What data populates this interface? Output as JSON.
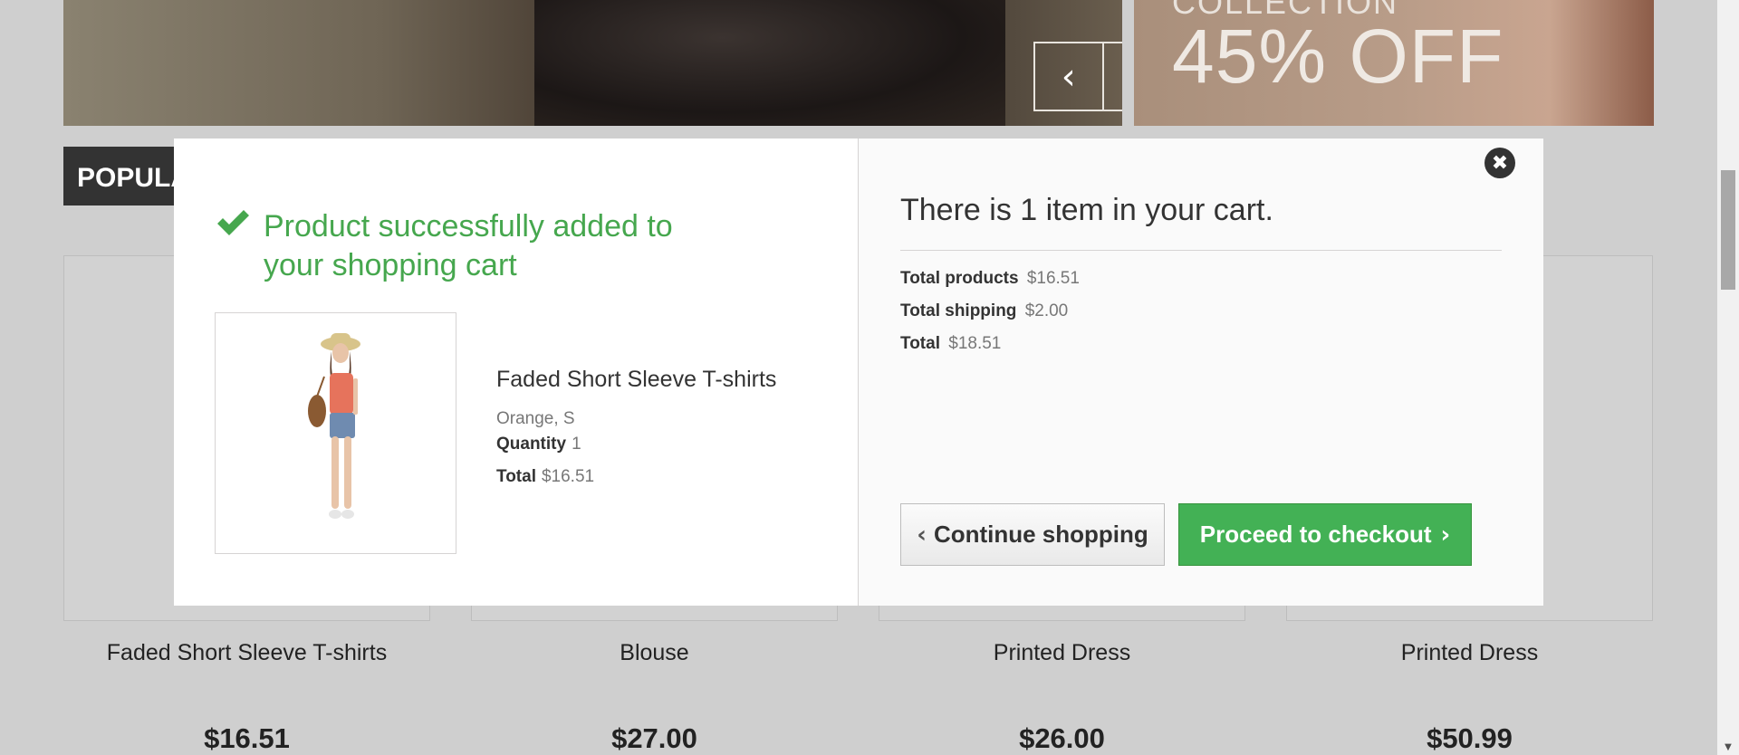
{
  "background": {
    "promo": {
      "collection_text": "COLLECTION",
      "discount_text": "45% OFF"
    },
    "slider": {
      "prev_glyph": "‹",
      "next_glyph": "›"
    },
    "popular_tab": "POPULAR",
    "products": [
      {
        "name": "Faded Short Sleeve T-shirts",
        "price": "$16.51"
      },
      {
        "name": "Blouse",
        "price": "$27.00"
      },
      {
        "name": "Printed Dress",
        "price": "$26.00"
      },
      {
        "name": "Printed Dress",
        "price": "$50.99"
      }
    ]
  },
  "modal": {
    "success_message": "Product successfully added to your shopping cart",
    "product": {
      "name": "Faded Short Sleeve T-shirts",
      "attributes": "Orange, S",
      "quantity_label": "Quantity",
      "quantity_value": "1",
      "total_label": "Total",
      "total_value": "$16.51"
    },
    "cart": {
      "title": "There is 1 item in your cart.",
      "total_products_label": "Total products",
      "total_products_value": "$16.51",
      "total_shipping_label": "Total shipping",
      "total_shipping_value": "$2.00",
      "total_label": "Total",
      "total_value": "$18.51"
    },
    "buttons": {
      "continue_label": "Continue shopping",
      "checkout_label": "Proceed to checkout"
    },
    "close_glyph": "✖"
  },
  "colors": {
    "success_green": "#46a74e",
    "checkout_green": "#43b155",
    "overlay": "#cfcfcf"
  }
}
